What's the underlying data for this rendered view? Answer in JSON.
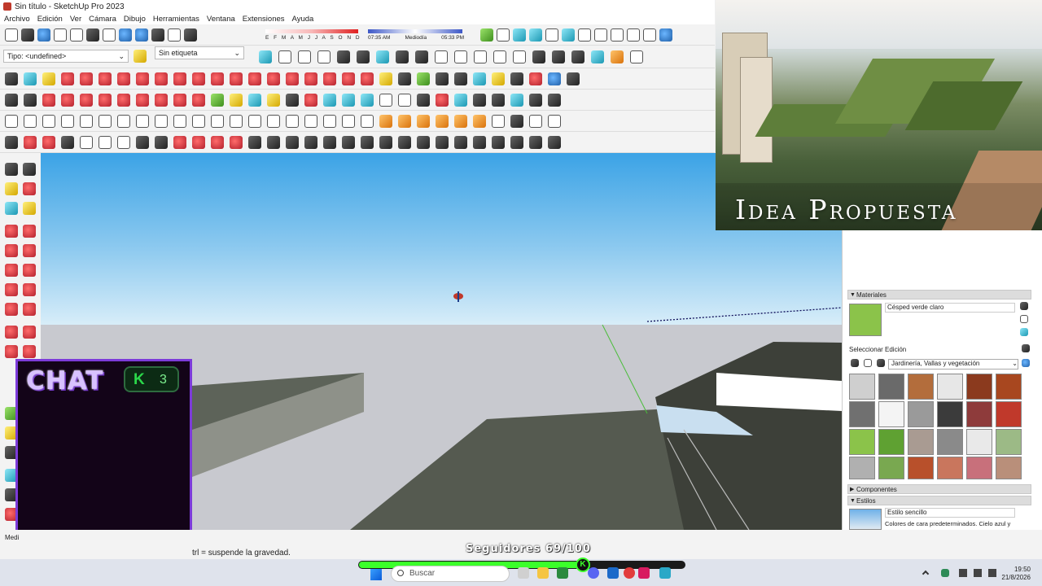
{
  "window": {
    "title": "Sin título - SketchUp Pro 2023"
  },
  "menu": [
    "Archivo",
    "Edición",
    "Ver",
    "Cámara",
    "Dibujo",
    "Herramientas",
    "Ventana",
    "Extensiones",
    "Ayuda"
  ],
  "toolbar": {
    "tipo_value": "Tipo: <undefined>",
    "etiqueta_value": "Sin etiqueta",
    "shadow_months": "E F M A M J J A S O N D",
    "time_start": "07:35 AM",
    "time_mid": "Mediodía",
    "time_end": "05:33 PM"
  },
  "overlay_image": {
    "caption": "Idea Propuesta"
  },
  "tray": {
    "materials_header": "Materiales",
    "material_name": "Césped verde claro",
    "tab_select": "Seleccionar",
    "tab_edit": "Edición",
    "library": "Jardinería, Vallas y vegetación",
    "components_header": "Componentes",
    "styles_header": "Estilos",
    "style_name": "Estilo sencillo",
    "style_desc": "Colores de cara predeterminados. Cielo azul y"
  },
  "chat": {
    "title": "CHAT",
    "kick_count": "3",
    "kick_letter": "K"
  },
  "status": {
    "left_label": "Medi",
    "message": "trl = suspende la gravedad.",
    "followers": "Seguidores 69/100",
    "followers_fraction": 0.69
  },
  "taskbar": {
    "search_placeholder": "Buscar",
    "time": "19:50",
    "date": "21/8/2026"
  },
  "colors": {
    "accent_purple": "#7c3bd9",
    "progress_green": "#3bff2a",
    "grass": "#8bc34a"
  }
}
